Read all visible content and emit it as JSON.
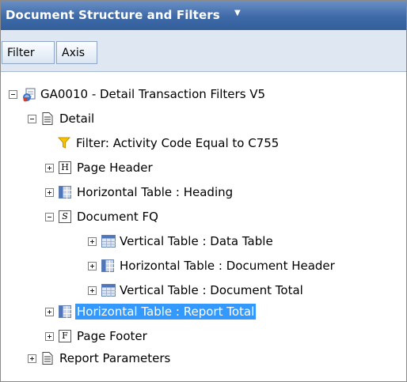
{
  "panel": {
    "title": "Document Structure and Filters"
  },
  "tabs": [
    {
      "label": "Filter"
    },
    {
      "label": "Axis"
    }
  ],
  "tree": {
    "root": "GA0010 - Detail Transaction Filters V5",
    "detail": "Detail",
    "filter": "Filter: Activity Code Equal to C755",
    "page_header": "Page Header",
    "heading_table": "Horizontal Table : Heading",
    "document_fq": "Document FQ",
    "data_table": "Vertical Table : Data Table",
    "doc_header_table": "Horizontal Table : Document Header",
    "doc_total_table": "Vertical Table : Document Total",
    "report_total_table": "Horizontal Table : Report Total",
    "page_footer": "Page Footer",
    "report_parameters": "Report Parameters"
  },
  "icon_letters": {
    "header": "H",
    "section": "S",
    "footer": "F"
  },
  "colors": {
    "title_bar": "#3e6aa8",
    "selection": "#3399ff",
    "toolbar": "#dfe8f2"
  }
}
